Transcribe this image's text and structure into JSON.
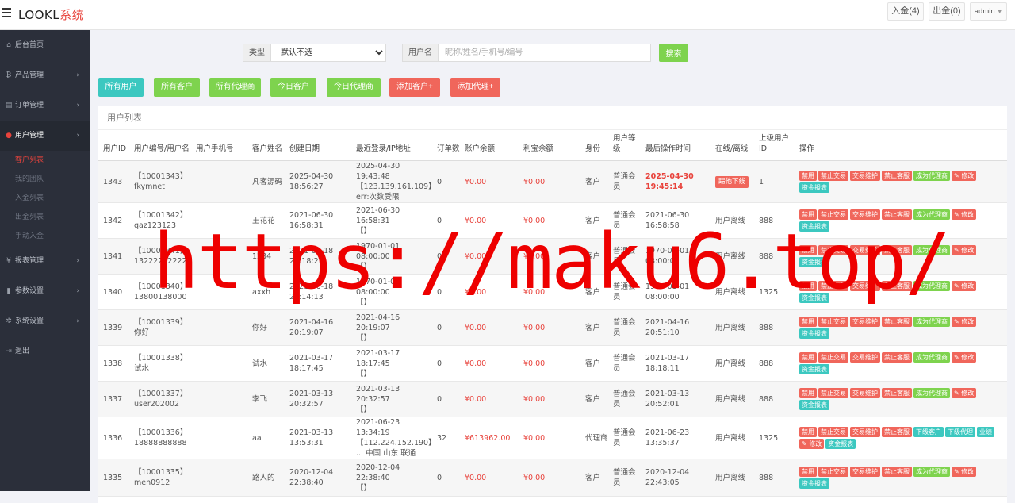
{
  "header": {
    "brand_main": "LOOKL",
    "brand_accent": "系统",
    "deposit_label": "入金(4)",
    "withdraw_label": "出金(0)",
    "admin_label": "admin"
  },
  "sidebar": {
    "items": [
      {
        "icon": "dashboard-icon",
        "glyph": "⌂",
        "label": "后台首页",
        "arrow": ""
      },
      {
        "icon": "bitcoin-icon",
        "glyph": "₿",
        "label": "产品管理",
        "arrow": "›"
      },
      {
        "icon": "copy-icon",
        "glyph": "▤",
        "label": "订单管理",
        "arrow": "›"
      },
      {
        "icon": "user-icon",
        "glyph": "●",
        "label": "用户管理",
        "arrow": "›"
      },
      {
        "icon": "yen-icon",
        "glyph": "¥",
        "label": "报表管理",
        "arrow": "›"
      },
      {
        "icon": "file-icon",
        "glyph": "▮",
        "label": "参数设置",
        "arrow": "›"
      },
      {
        "icon": "gears-icon",
        "glyph": "✲",
        "label": "系统设置",
        "arrow": "›"
      },
      {
        "icon": "logout-icon",
        "glyph": "⇥",
        "label": "退出",
        "arrow": ""
      }
    ],
    "sub_items": [
      "客户列表",
      "我的团队",
      "入金列表",
      "出金列表",
      "手动入金"
    ]
  },
  "search": {
    "type_label": "类型",
    "type_value": "默认不选",
    "user_label": "用户名",
    "user_placeholder": "昵称/姓名/手机号/编号",
    "search_label": "搜索"
  },
  "quick_buttons": [
    {
      "label": "所有用户",
      "color": "teal"
    },
    {
      "label": "所有客户",
      "color": "green"
    },
    {
      "label": "所有代理商",
      "color": "green"
    },
    {
      "label": "今日客户",
      "color": "green"
    },
    {
      "label": "今日代理商",
      "color": "green"
    },
    {
      "label": "添加客户+",
      "color": "red"
    },
    {
      "label": "添加代理+",
      "color": "red"
    }
  ],
  "table": {
    "title": "用户列表",
    "columns": [
      "用户ID",
      "用户编号/用户名",
      "用户手机号",
      "客户姓名",
      "创建日期",
      "最近登录/IP地址",
      "订单数",
      "账户余额",
      "利宝余额",
      "身份",
      "用户等级",
      "最后操作时间",
      "在线/离线",
      "上级用户ID",
      "操作"
    ],
    "rows": [
      {
        "id": "1343",
        "code": "【10001343】",
        "username": "fkymnet",
        "phone": "",
        "name": "凡客源码",
        "created": "2025-04-30 18:56:27",
        "login": "2025-04-30 19:43:48",
        "ip": "【123.139.161.109】",
        "ip2": "err:次数受限",
        "orders": "0",
        "balance": "¥0.00",
        "libao": "¥0.00",
        "identity": "客户",
        "level": "普通会员",
        "last_op": "2025-04-30 19:45:14",
        "last_op_highlight": true,
        "status": "踢他下线",
        "status_badge": true,
        "parent": "1",
        "ops": [
          [
            "禁用",
            "r"
          ],
          [
            "禁止交易",
            "r"
          ],
          [
            "交易维护",
            "r"
          ],
          [
            "禁止客服",
            "r"
          ],
          [
            "成为代理商",
            "g"
          ],
          [
            "✎ 修改",
            "r"
          ],
          [
            "资金报表",
            "t"
          ]
        ]
      },
      {
        "id": "1342",
        "code": "【10001342】",
        "username": "qaz123123",
        "phone": "",
        "name": "王花花",
        "created": "2021-06-30 16:58:31",
        "login": "2021-06-30 16:58:31",
        "ip": "【】",
        "ip2": "",
        "orders": "0",
        "balance": "¥0.00",
        "libao": "¥0.00",
        "identity": "客户",
        "level": "普通会员",
        "last_op": "2021-06-30 16:58:58",
        "last_op_highlight": false,
        "status": "用户离线",
        "status_badge": false,
        "parent": "888",
        "ops": [
          [
            "禁用",
            "r"
          ],
          [
            "禁止交易",
            "r"
          ],
          [
            "交易维护",
            "r"
          ],
          [
            "禁止客服",
            "r"
          ],
          [
            "成为代理商",
            "g"
          ],
          [
            "✎ 修改",
            "r"
          ],
          [
            "资金报表",
            "t"
          ]
        ]
      },
      {
        "id": "1341",
        "code": "【10001341】",
        "username": "13222222222",
        "phone": "",
        "name": "1234",
        "created": "2021-06-18 21:18:23",
        "login": "1970-01-01 08:00:00",
        "ip": "【】",
        "ip2": "",
        "orders": "0",
        "balance": "¥0.00",
        "libao": "¥0.00",
        "identity": "客户",
        "level": "普通会员",
        "last_op": "1970-01-01 08:00:00",
        "last_op_highlight": false,
        "status": "用户离线",
        "status_badge": false,
        "parent": "888",
        "ops": [
          [
            "禁用",
            "r"
          ],
          [
            "禁止交易",
            "r"
          ],
          [
            "交易维护",
            "r"
          ],
          [
            "禁止客服",
            "r"
          ],
          [
            "成为代理商",
            "g"
          ],
          [
            "✎ 修改",
            "r"
          ],
          [
            "资金报表",
            "t"
          ]
        ]
      },
      {
        "id": "1340",
        "code": "【10001340】",
        "username": "13800138000",
        "phone": "",
        "name": "axxh",
        "created": "2021-06-18 21:14:13",
        "login": "1970-01-01 08:00:00",
        "ip": "【】",
        "ip2": "",
        "orders": "0",
        "balance": "¥0.00",
        "libao": "¥0.00",
        "identity": "客户",
        "level": "普通会员",
        "last_op": "1970-01-01 08:00:00",
        "last_op_highlight": false,
        "status": "用户离线",
        "status_badge": false,
        "parent": "1325",
        "ops": [
          [
            "禁用",
            "r"
          ],
          [
            "禁止交易",
            "r"
          ],
          [
            "交易维护",
            "r"
          ],
          [
            "禁止客服",
            "r"
          ],
          [
            "成为代理商",
            "g"
          ],
          [
            "✎ 修改",
            "r"
          ],
          [
            "资金报表",
            "t"
          ]
        ]
      },
      {
        "id": "1339",
        "code": "【10001339】",
        "username": "你好",
        "phone": "",
        "name": "你好",
        "created": "2021-04-16 20:19:07",
        "login": "2021-04-16 20:19:07",
        "ip": "【】",
        "ip2": "",
        "orders": "0",
        "balance": "¥0.00",
        "libao": "¥0.00",
        "identity": "客户",
        "level": "普通会员",
        "last_op": "2021-04-16 20:51:10",
        "last_op_highlight": false,
        "status": "用户离线",
        "status_badge": false,
        "parent": "888",
        "ops": [
          [
            "禁用",
            "r"
          ],
          [
            "禁止交易",
            "r"
          ],
          [
            "交易维护",
            "r"
          ],
          [
            "禁止客服",
            "r"
          ],
          [
            "成为代理商",
            "g"
          ],
          [
            "✎ 修改",
            "r"
          ],
          [
            "资金报表",
            "t"
          ]
        ]
      },
      {
        "id": "1338",
        "code": "【10001338】",
        "username": "试水",
        "phone": "",
        "name": "试水",
        "created": "2021-03-17 18:17:45",
        "login": "2021-03-17 18:17:45",
        "ip": "【】",
        "ip2": "",
        "orders": "0",
        "balance": "¥0.00",
        "libao": "¥0.00",
        "identity": "客户",
        "level": "普通会员",
        "last_op": "2021-03-17 18:18:11",
        "last_op_highlight": false,
        "status": "用户离线",
        "status_badge": false,
        "parent": "888",
        "ops": [
          [
            "禁用",
            "r"
          ],
          [
            "禁止交易",
            "r"
          ],
          [
            "交易维护",
            "r"
          ],
          [
            "禁止客服",
            "r"
          ],
          [
            "成为代理商",
            "g"
          ],
          [
            "✎ 修改",
            "r"
          ],
          [
            "资金报表",
            "t"
          ]
        ]
      },
      {
        "id": "1337",
        "code": "【10001337】",
        "username": "user202002",
        "phone": "",
        "name": "李飞",
        "created": "2021-03-13 20:32:57",
        "login": "2021-03-13 20:32:57",
        "ip": "【】",
        "ip2": "",
        "orders": "0",
        "balance": "¥0.00",
        "libao": "¥0.00",
        "identity": "客户",
        "level": "普通会员",
        "last_op": "2021-03-13 20:52:01",
        "last_op_highlight": false,
        "status": "用户离线",
        "status_badge": false,
        "parent": "888",
        "ops": [
          [
            "禁用",
            "r"
          ],
          [
            "禁止交易",
            "r"
          ],
          [
            "交易维护",
            "r"
          ],
          [
            "禁止客服",
            "r"
          ],
          [
            "成为代理商",
            "g"
          ],
          [
            "✎ 修改",
            "r"
          ],
          [
            "资金报表",
            "t"
          ]
        ]
      },
      {
        "id": "1336",
        "code": "【10001336】",
        "username": "18888888888",
        "phone": "",
        "name": "aa",
        "created": "2021-03-13 13:53:31",
        "login": "2021-06-23 13:34:19",
        "ip": "【112.224.152.190】",
        "ip2": "... 中国 山东 联通",
        "orders": "32",
        "balance": "¥613962.00",
        "libao": "¥0.00",
        "identity": "代理商",
        "level": "普通会员",
        "last_op": "2021-06-23 13:35:37",
        "last_op_highlight": false,
        "status": "用户离线",
        "status_badge": false,
        "parent": "1325",
        "ops": [
          [
            "禁用",
            "r"
          ],
          [
            "禁止交易",
            "r"
          ],
          [
            "交易维护",
            "r"
          ],
          [
            "禁止客服",
            "r"
          ],
          [
            "下级客户",
            "t"
          ],
          [
            "下级代理",
            "t"
          ],
          [
            "业绩",
            "t"
          ],
          [
            "✎ 修改",
            "r"
          ],
          [
            "资金报表",
            "t"
          ]
        ]
      },
      {
        "id": "1335",
        "code": "【10001335】",
        "username": "men0912",
        "phone": "",
        "name": "路人的",
        "created": "2020-12-04 22:38:40",
        "login": "2020-12-04 22:38:40",
        "ip": "【】",
        "ip2": "",
        "orders": "0",
        "balance": "¥0.00",
        "libao": "¥0.00",
        "identity": "客户",
        "level": "普通会员",
        "last_op": "2020-12-04 22:43:05",
        "last_op_highlight": false,
        "status": "用户离线",
        "status_badge": false,
        "parent": "888",
        "ops": [
          [
            "禁用",
            "r"
          ],
          [
            "禁止交易",
            "r"
          ],
          [
            "交易维护",
            "r"
          ],
          [
            "禁止客服",
            "r"
          ],
          [
            "成为代理商",
            "g"
          ],
          [
            "✎ 修改",
            "r"
          ],
          [
            "资金报表",
            "t"
          ]
        ]
      }
    ]
  },
  "watermark": "https://maku6.top/"
}
